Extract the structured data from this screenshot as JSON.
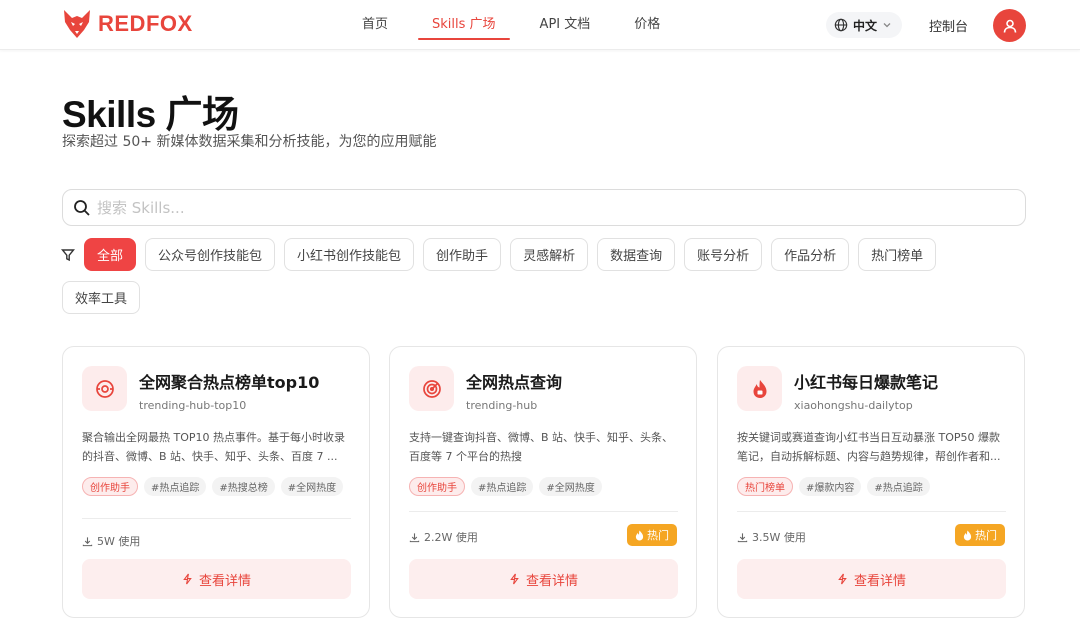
{
  "header": {
    "brand": "REDFOX",
    "nav": [
      {
        "label": "首页",
        "active": false
      },
      {
        "label": "Skills 广场",
        "active": true
      },
      {
        "label": "API 文档",
        "active": false
      },
      {
        "label": "价格",
        "active": false
      }
    ],
    "language": "中文",
    "console": "控制台"
  },
  "hero": {
    "title": "Skills 广场",
    "subtitle": "探索超过 50+ 新媒体数据采集和分析技能，为您的应用赋能"
  },
  "search": {
    "placeholder": "搜索 Skills...",
    "value": ""
  },
  "filters": {
    "chips": [
      "全部",
      "公众号创作技能包",
      "小红书创作技能包",
      "创作助手",
      "灵感解析",
      "数据查询",
      "账号分析",
      "作品分析",
      "热门榜单",
      "效率工具"
    ],
    "selected": "全部"
  },
  "cards": [
    {
      "title": "全网聚合热点榜单top10",
      "slug": "trending-hub-top10",
      "description": "聚合输出全网最热 TOP10 热点事件。基于每小时收录的抖音、微博、B 站、快手、知乎、头条、百度 7 ...",
      "category": "创作助手",
      "tags": [
        "#热点追踪",
        "#热搜总榜",
        "#全网热度"
      ],
      "usage": "5W 使用",
      "hot_label": "",
      "button": "查看详情",
      "icon": "radar-icon"
    },
    {
      "title": "全网热点查询",
      "slug": "trending-hub",
      "description": "支持一键查询抖音、微博、B 站、快手、知乎、头条、百度等 7 个平台的热搜",
      "category": "创作助手",
      "tags": [
        "#热点追踪",
        "#全网热度"
      ],
      "usage": "2.2W 使用",
      "hot_label": "热门",
      "button": "查看详情",
      "icon": "target-icon"
    },
    {
      "title": "小红书每日爆款笔记",
      "slug": "xiaohongshu-dailytop",
      "description": "按关键词或赛道查询小红书当日互动暴涨 TOP50 爆款笔记，自动拆解标题、内容与趋势规律，帮创作者和...",
      "category": "热门榜单",
      "tags": [
        "#爆款内容",
        "#热点追踪"
      ],
      "usage": "3.5W 使用",
      "hot_label": "热门",
      "button": "查看详情",
      "icon": "flame-icon"
    }
  ],
  "colors": {
    "accent": "#e8453c",
    "accent_soft": "#fdecec",
    "hot": "#f5a623"
  }
}
